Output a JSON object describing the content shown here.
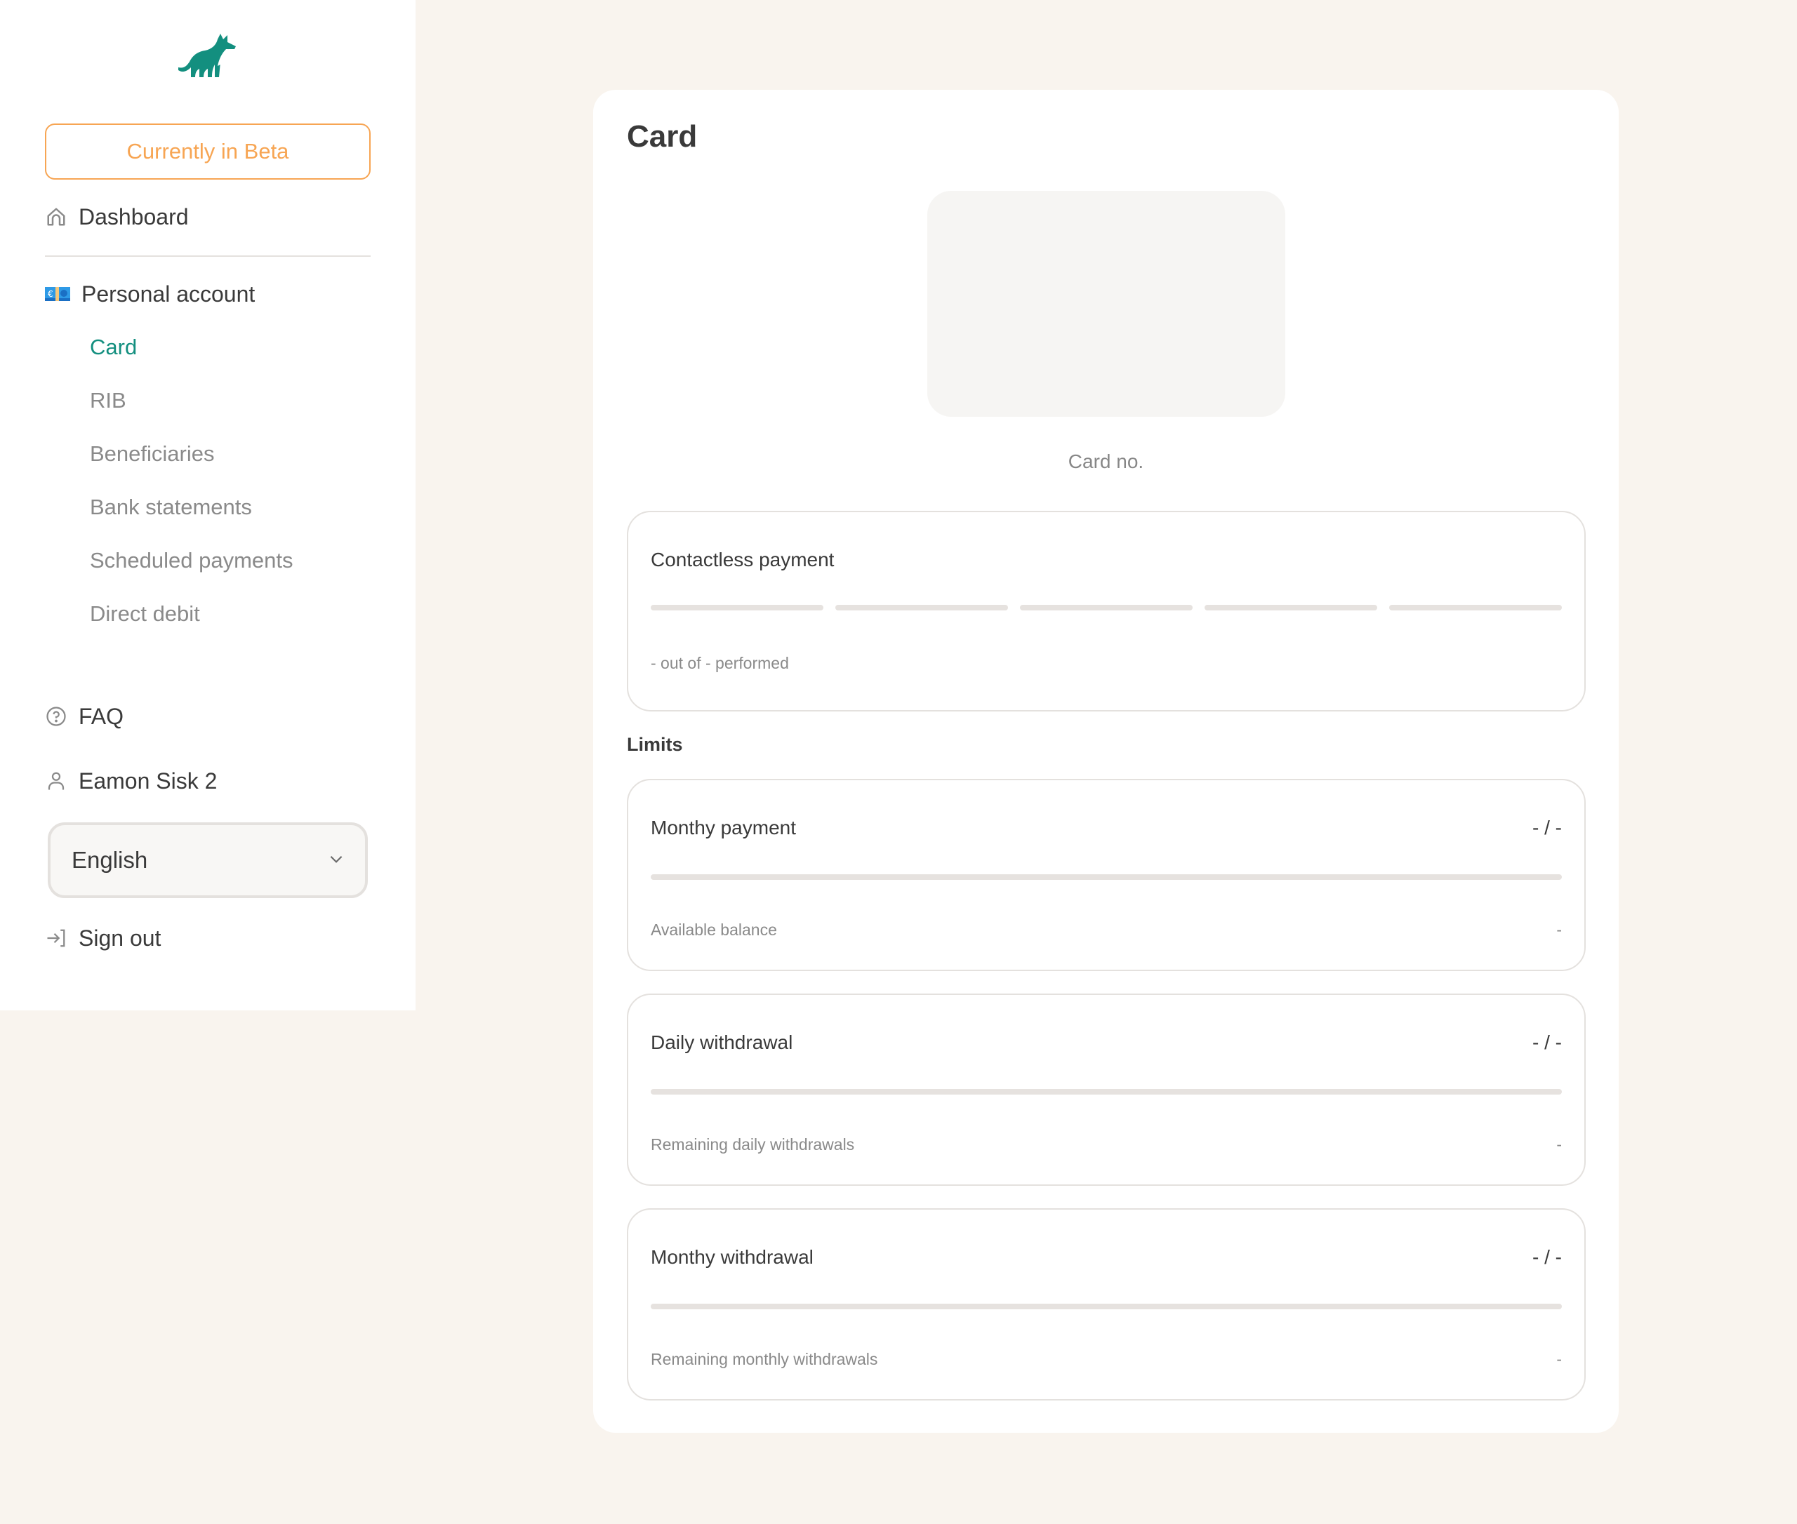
{
  "sidebar": {
    "logo": "fox-logo",
    "beta_label": "Currently in Beta",
    "dashboard": {
      "label": "Dashboard",
      "icon": "home-icon"
    },
    "personal_account": {
      "label": "Personal account",
      "icon": "euro-banknote-icon"
    },
    "sub_items": [
      {
        "label": "Card",
        "active": true
      },
      {
        "label": "RIB",
        "active": false
      },
      {
        "label": "Beneficiaries",
        "active": false
      },
      {
        "label": "Bank statements",
        "active": false
      },
      {
        "label": "Scheduled payments",
        "active": false
      },
      {
        "label": "Direct debit",
        "active": false
      }
    ],
    "faq": {
      "label": "FAQ",
      "icon": "help-circle-icon"
    },
    "user": {
      "label": "Eamon Sisk 2",
      "icon": "user-icon"
    },
    "language": {
      "selected": "English"
    },
    "sign_out": {
      "label": "Sign out",
      "icon": "sign-out-icon"
    }
  },
  "main": {
    "title": "Card",
    "card_number_label": "Card no.",
    "contactless": {
      "title": "Contactless payment",
      "segments_total": 5,
      "segments_filled": 0,
      "status_text": "- out of - performed"
    },
    "limits_title": "Limits",
    "limits": [
      {
        "title": "Monthy payment",
        "value": "- / -",
        "progress": 0,
        "sub_label": "Available balance",
        "sub_value": "-"
      },
      {
        "title": "Daily withdrawal",
        "value": "- / -",
        "progress": 0,
        "sub_label": "Remaining daily withdrawals",
        "sub_value": "-"
      },
      {
        "title": "Monthy withdrawal",
        "value": "- / -",
        "progress": 0,
        "sub_label": "Remaining monthly withdrawals",
        "sub_value": "-"
      }
    ]
  },
  "colors": {
    "accent": "#138f7f",
    "beta": "#f7a553",
    "background": "#f9f4ee",
    "track": "#e6e2df"
  }
}
